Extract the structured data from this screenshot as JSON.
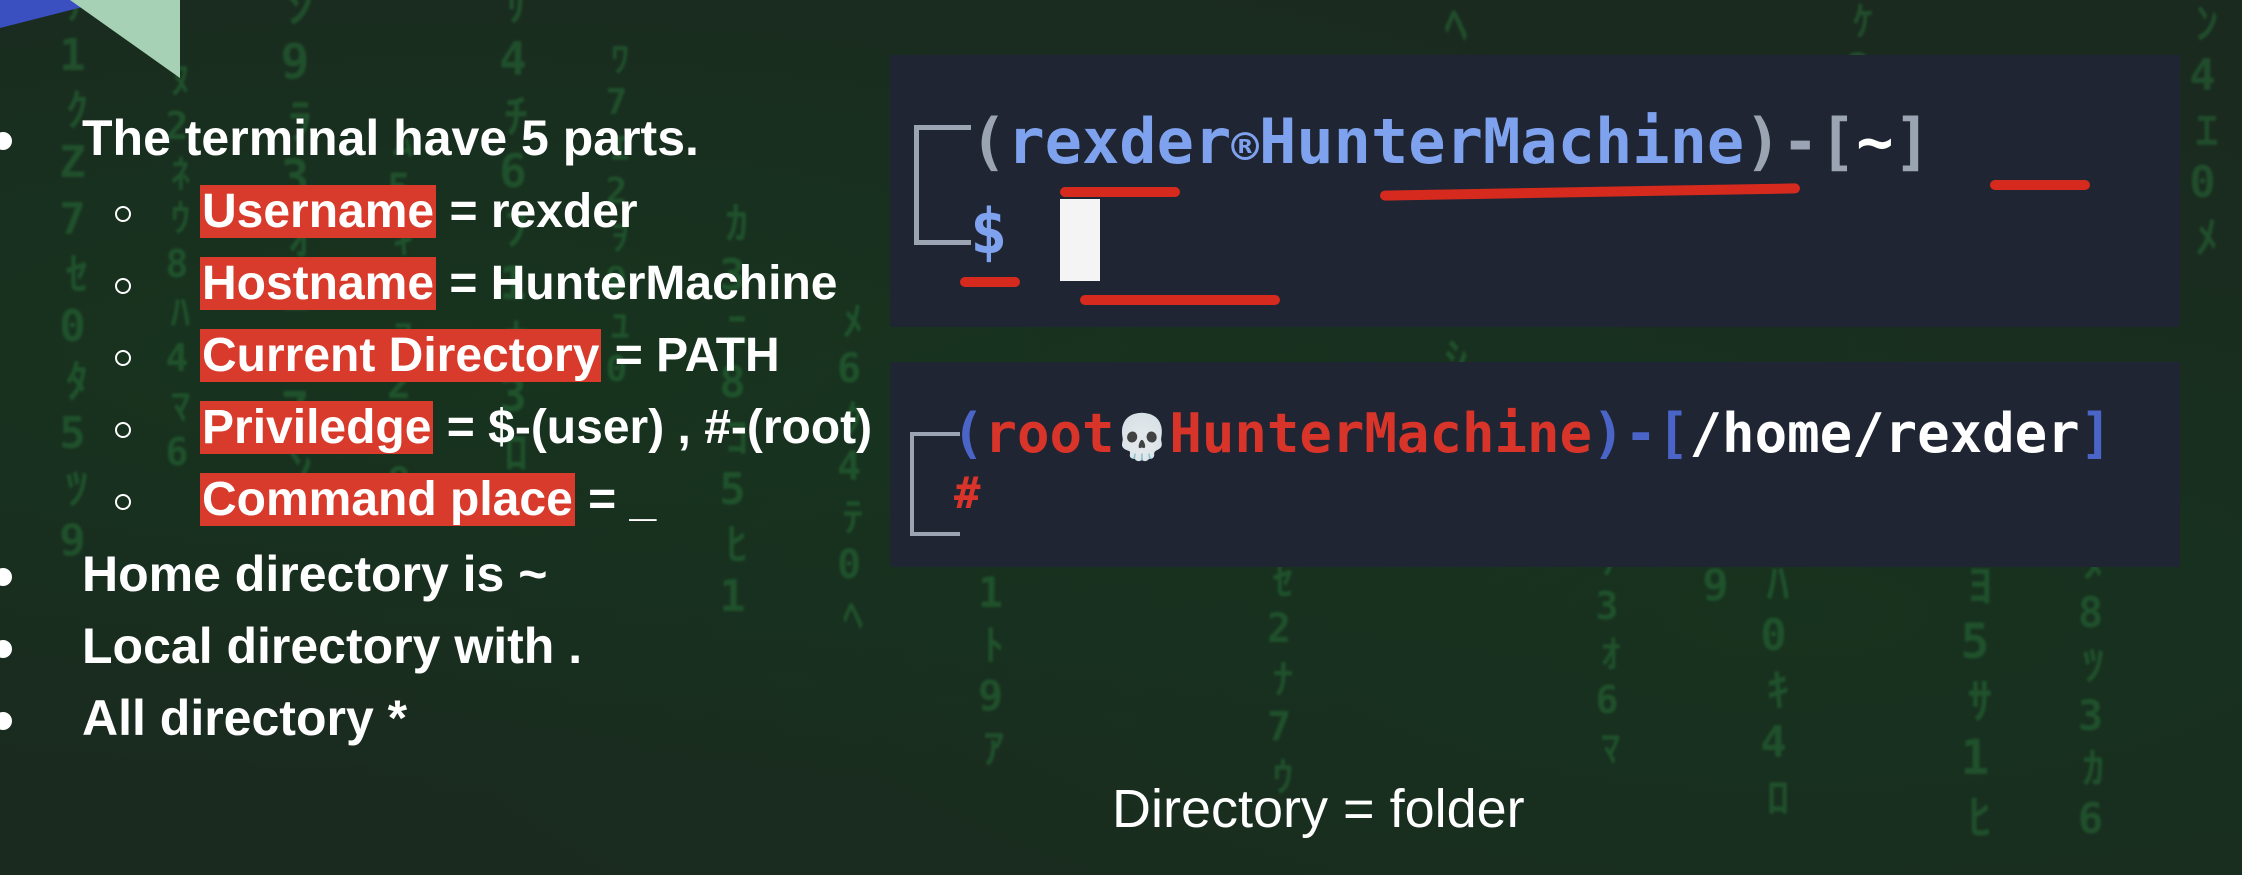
{
  "bullets": {
    "intro": "The terminal have 5 parts.",
    "parts": [
      {
        "label": "Username",
        "rest": " = rexder"
      },
      {
        "label": "Hostname",
        "rest": " = HunterMachine"
      },
      {
        "label": "Current Directory",
        "rest": " = PATH"
      },
      {
        "label": "Priviledge",
        "rest": " = $-(user) , #-(root)"
      },
      {
        "label": "Command place",
        "rest": " = _"
      }
    ],
    "home": "Home directory is ~",
    "local": "Local directory with .",
    "all": "All directory *"
  },
  "terminal_user": {
    "open": "(",
    "username": "rexder",
    "at_icon": "®",
    "hostname": "HunterMachine",
    "close": ")-[",
    "path": "~",
    "end": "]",
    "prompt": "$"
  },
  "terminal_root": {
    "open": "(",
    "username": "root",
    "at_icon": "💀",
    "hostname": "HunterMachine",
    "close": ")-[",
    "path": "/home/rexder",
    "end": "]",
    "prompt": "#"
  },
  "caption": "Directory = folder",
  "colors": {
    "highlight": "#d83b2c",
    "user_blue": "#7fa2ee",
    "root_red": "#d9342a",
    "terminal_bg": "#1f2532",
    "matrix_green": "#2f8f45"
  }
}
